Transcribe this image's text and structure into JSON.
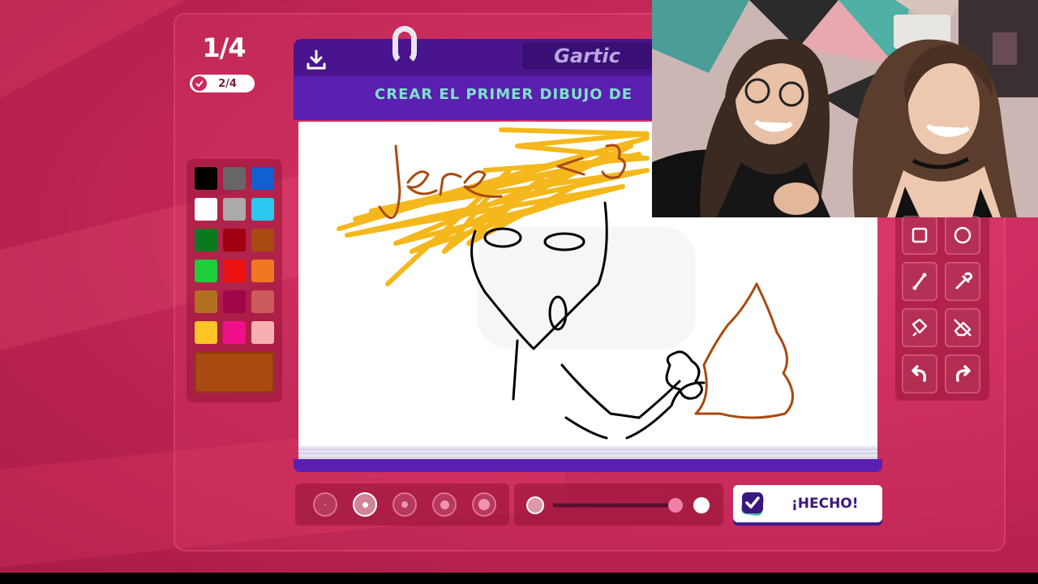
{
  "game": {
    "round_counter": "1/4",
    "players_done": "2/4",
    "logo_text": "Gartic",
    "instruction": "CREAR EL PRIMER DIBUJO DE",
    "done_button_label": "¡HECHO!",
    "canvas_text": "Jere <3"
  },
  "palette": {
    "colors": [
      "#000000",
      "#666666",
      "#1060d0",
      "#ffffff",
      "#aaaaaa",
      "#2dc6f0",
      "#0b7a1e",
      "#a00010",
      "#a94a10",
      "#1fcc3a",
      "#ee1111",
      "#f07820",
      "#b07020",
      "#a0064a",
      "#cc5a5a",
      "#ffc426",
      "#f0108a",
      "#f6b0b0"
    ],
    "selected": "#a94a10"
  },
  "tools": [
    "square-icon",
    "circle-icon",
    "line-icon",
    "eyedropper-icon",
    "fill-icon",
    "eraser-icon",
    "undo-icon",
    "redo-icon"
  ],
  "brush_sizes": {
    "count": 5,
    "selected_index": 1
  },
  "opacity": {
    "value": 1.0
  }
}
